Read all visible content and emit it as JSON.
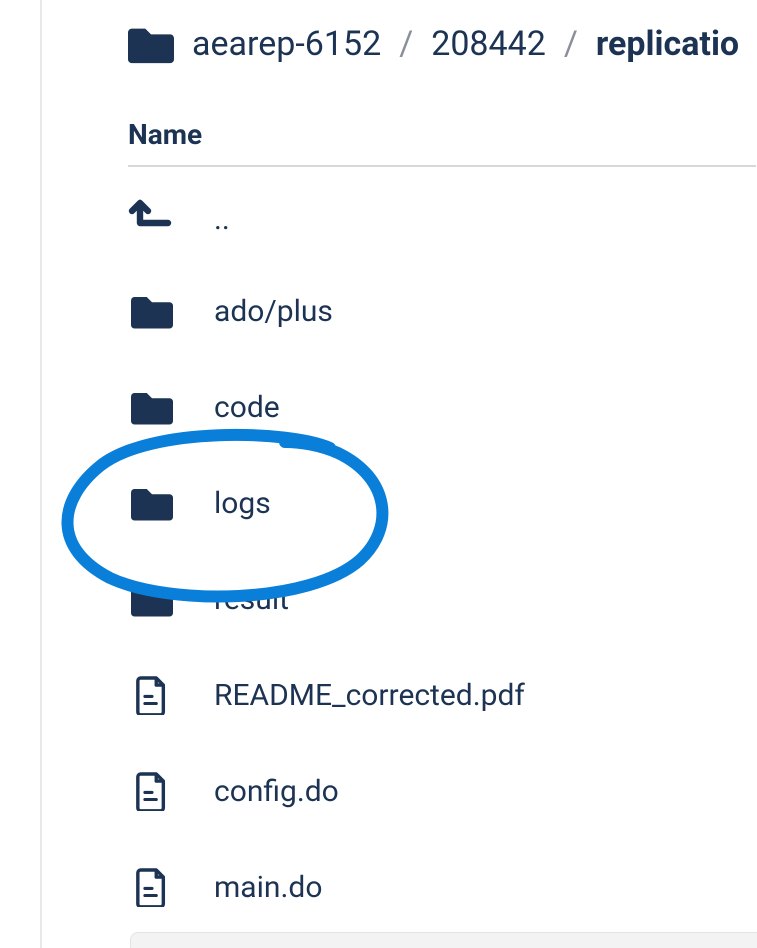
{
  "breadcrumb": {
    "crumb1": "aearep-6152",
    "sep": "/",
    "crumb2": "208442",
    "crumb3": "replicatio"
  },
  "table": {
    "header_name": "Name"
  },
  "rows": {
    "parent": "..",
    "ado_plus": "ado/plus",
    "code": "code",
    "logs": "logs",
    "result": "result",
    "readme": "README_corrected.pdf",
    "config": "config.do",
    "main": "main.do"
  }
}
